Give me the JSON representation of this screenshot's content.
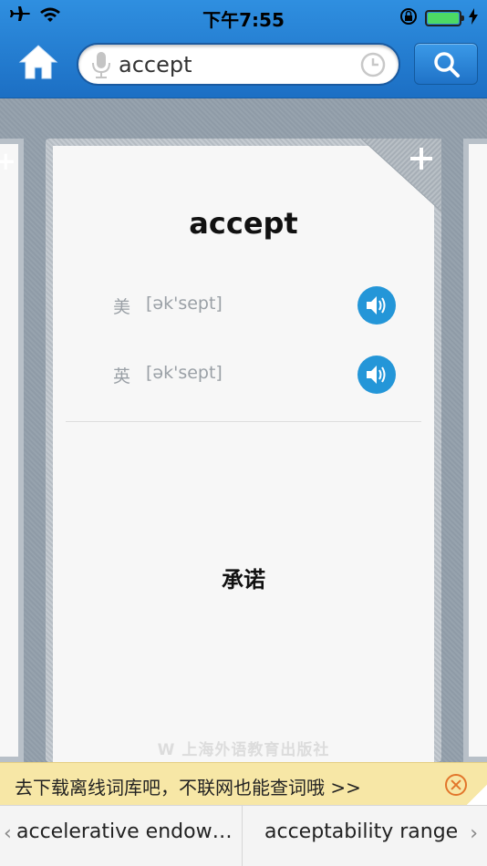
{
  "status": {
    "time": "下午7:55",
    "battery_level": 1.0,
    "battery_color": "#4cd964"
  },
  "search": {
    "value": "accept"
  },
  "card": {
    "word": "accept",
    "pronunciations": [
      {
        "region": "美",
        "phonetic": "[ək'sept]"
      },
      {
        "region": "英",
        "phonetic": "[ək'sept]"
      }
    ],
    "meaning": "承诺",
    "publisher": "上海外语教育出版社"
  },
  "banner": {
    "text": "去下载离线词库吧，不联网也能查词哦 >>"
  },
  "nav": {
    "prev": "accelerative endowm...",
    "next": "acceptability range"
  },
  "colors": {
    "accent": "#2496d8",
    "topbar": "#1c6fc4",
    "banner": "#f7e7a6"
  }
}
